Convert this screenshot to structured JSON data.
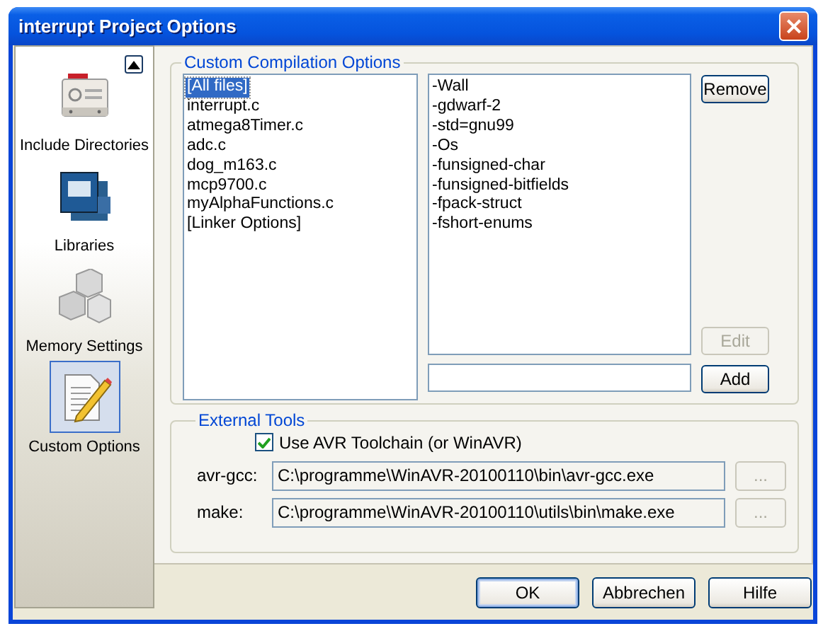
{
  "window": {
    "title": "interrupt Project Options",
    "close": "×"
  },
  "sidebar": {
    "items": [
      {
        "kind": "card",
        "label": "Include Directories",
        "selected": false
      },
      {
        "kind": "book",
        "label": "Libraries",
        "selected": false
      },
      {
        "kind": "cubes",
        "label": "Memory Settings",
        "selected": false
      },
      {
        "kind": "notepad",
        "label": "Custom Options",
        "selected": true
      }
    ]
  },
  "custom_compilation_options": {
    "title": "Custom Compilation Options",
    "files": [
      {
        "label": "[All files]",
        "selected": true
      },
      {
        "label": "interrupt.c",
        "selected": false
      },
      {
        "label": "atmega8Timer.c",
        "selected": false
      },
      {
        "label": "adc.c",
        "selected": false
      },
      {
        "label": "dog_m163.c",
        "selected": false
      },
      {
        "label": "mcp9700.c",
        "selected": false
      },
      {
        "label": "myAlphaFunctions.c",
        "selected": false
      },
      {
        "label": "[Linker Options]",
        "selected": false
      }
    ],
    "options": [
      "-Wall",
      "-gdwarf-2",
      "-std=gnu99",
      "-Os",
      "-funsigned-char",
      "-funsigned-bitfields",
      "-fpack-struct",
      "-fshort-enums"
    ],
    "buttons": [
      {
        "kind": "remove",
        "label": "Remove",
        "disabled": false
      },
      {
        "kind": "edit",
        "label": "Edit",
        "disabled": true
      },
      {
        "kind": "add",
        "label": "Add",
        "disabled": false
      }
    ]
  },
  "external_tools": {
    "title": "External Tools",
    "use_toolchain": {
      "label": "Use AVR Toolchain (or WinAVR)",
      "checked": true
    },
    "tools": [
      {
        "label": "avr-gcc:",
        "value": "C:\\programme\\WinAVR-20100110\\bin\\avr-gcc.exe",
        "browse": "...",
        "browse_disabled": true
      },
      {
        "label": "make:",
        "value": "C:\\programme\\WinAVR-20100110\\utils\\bin\\make.exe",
        "browse": "...",
        "browse_disabled": true
      }
    ]
  },
  "buttons": [
    {
      "label": "OK",
      "default": true
    },
    {
      "label": "Abbrechen",
      "default": false
    },
    {
      "label": "Hilfe",
      "default": false
    }
  ]
}
